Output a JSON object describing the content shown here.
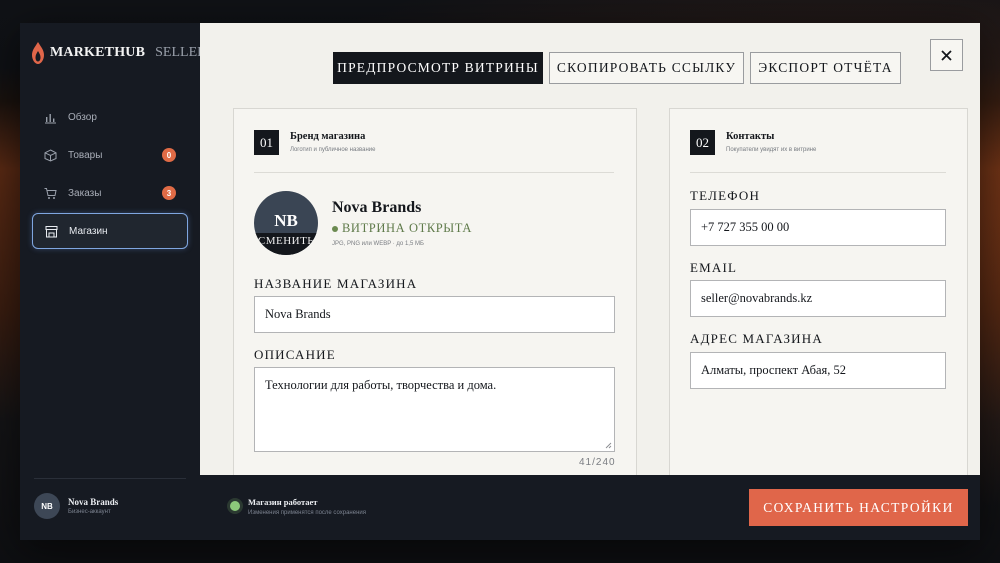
{
  "app": {
    "brand": "MARKETHUB",
    "brand_suffix": "SELLER"
  },
  "sidebar": {
    "items": [
      {
        "label": "Обзор",
        "icon": "chart-icon",
        "badge": ""
      },
      {
        "label": "Товары",
        "icon": "box-icon",
        "badge": "0"
      },
      {
        "label": "Заказы",
        "icon": "cart-icon",
        "badge": "3"
      },
      {
        "label": "Магазин",
        "icon": "store-icon",
        "badge": "",
        "active": true
      }
    ],
    "account": {
      "initials": "NB",
      "name": "Nova Brands",
      "role": "Бизнес-аккаунт"
    }
  },
  "toolbar": {
    "preview_label": "ПРЕДПРОСМОТР ВИТРИНЫ",
    "copy_link_label": "СКОПИРОВАТЬ ССЫЛКУ",
    "export_label": "ЭКСПОРТ ОТЧЁТА",
    "close_icon": "close-icon"
  },
  "brand_card": {
    "step": "01",
    "title": "Бренд магазина",
    "subtitle": "Логотип и публичное название",
    "logo_initials": "NB",
    "logo_change_label": "СМЕНИТЬ",
    "store_name": "Nova Brands",
    "store_status": "ВИТРИНА ОТКРЫТА",
    "logo_hint": "JPG, PNG или WEBP · до 1,5 МБ",
    "name_label": "НАЗВАНИЕ МАГАЗИНА",
    "name_value": "Nova Brands",
    "description_label": "ОПИСАНИЕ",
    "description_value": "Технологии для работы, творчества и дома.",
    "description_counter": "41/240"
  },
  "contacts_card": {
    "step": "02",
    "title": "Контакты",
    "subtitle": "Покупатели увидят их в витрине",
    "phone_label": "ТЕЛЕФОН",
    "phone_value": "+7 727 355 00 00",
    "email_label": "EMAIL",
    "email_value": "seller@novabrands.kz",
    "address_label": "АДРЕС МАГАЗИНА",
    "address_value": "Алматы, проспект Абая, 52"
  },
  "footer": {
    "status_title": "Магазин работает",
    "status_sub": "Изменения применятся после сохранения",
    "save_label": "СОХРАНИТЬ НАСТРОЙКИ"
  },
  "colors": {
    "accent": "#e0664a",
    "dark": "#14171c",
    "sidebar": "#161a22",
    "success": "#8cc87a",
    "active_outline": "#7fa6e0"
  }
}
